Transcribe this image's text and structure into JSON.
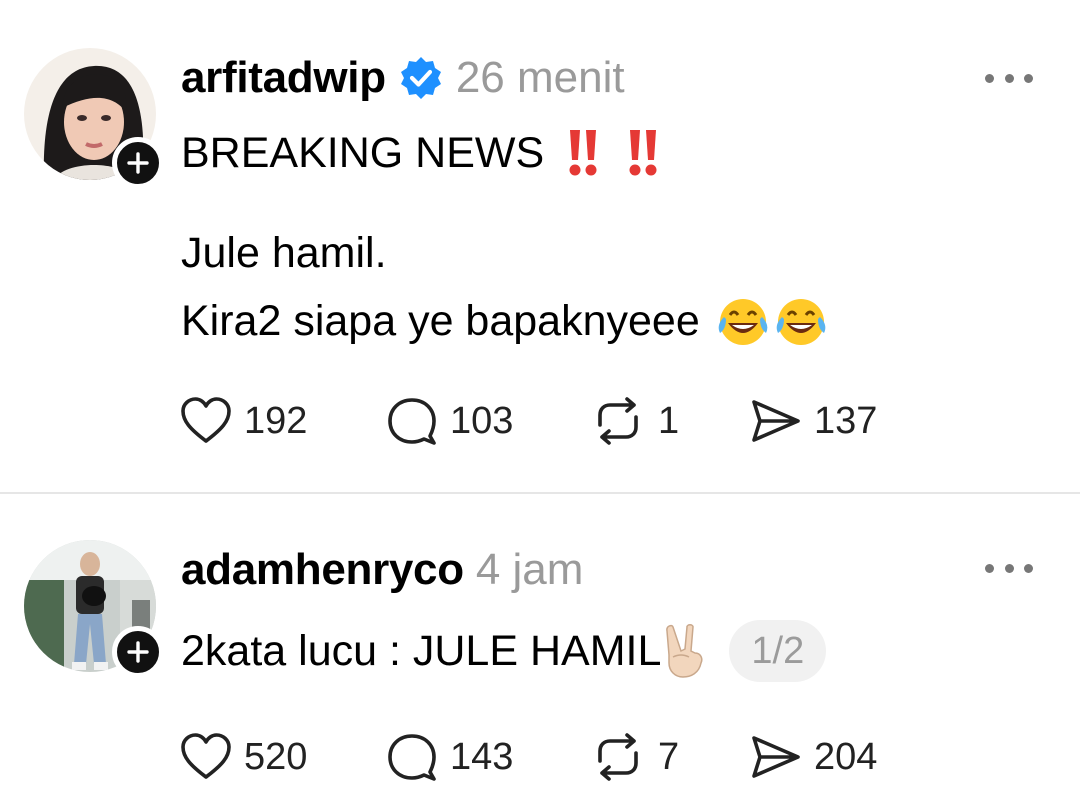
{
  "posts": [
    {
      "username": "arfitadwip",
      "verified": true,
      "time": "26 menit",
      "lines": [
        "BREAKING NEWS",
        "Jule hamil.",
        "Kira2 siapa ye bapaknyeee"
      ],
      "emojis": [
        "double-exclamation-icon",
        "double-exclamation-icon",
        "tears-of-joy-icon",
        "tears-of-joy-icon"
      ],
      "likes": "192",
      "replies": "103",
      "reposts": "1",
      "shares": "137"
    },
    {
      "username": "adamhenryco",
      "verified": false,
      "time": "4 jam",
      "lines": [
        "2kata lucu : JULE HAMIL"
      ],
      "emojis": [
        "victory-hand-icon"
      ],
      "page_indicator": "1/2",
      "likes": "520",
      "replies": "143",
      "reposts": "7",
      "shares": "204"
    }
  ],
  "colors": {
    "verified": "#1e90ff",
    "muted_text": "#9a9a9a",
    "divider": "#e6e6e6",
    "emoji_red": "#e53935",
    "emoji_yellow": "#ffc928"
  }
}
